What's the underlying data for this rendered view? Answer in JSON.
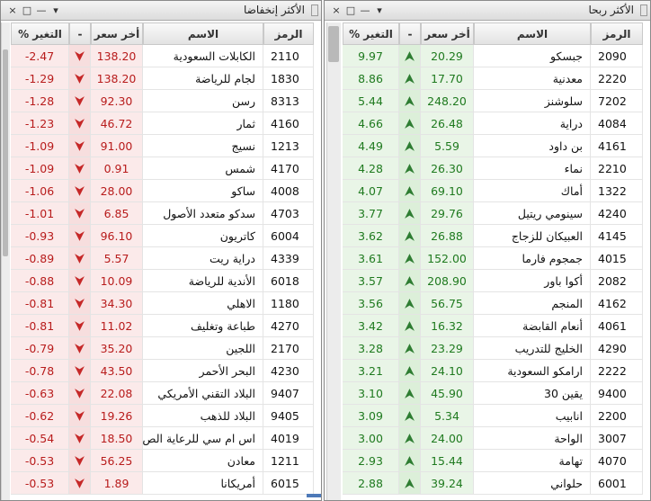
{
  "panels": {
    "losers": {
      "title": "الأكثر إنخفاضا",
      "columns": {
        "symbol": "الرمز",
        "name": "الاسم",
        "last_price": "أخر سعر",
        "trend": "-",
        "change": "التغير %"
      },
      "arrow_direction": "down",
      "rows": [
        {
          "symbol": "2110",
          "name": "الكابلات السعودية",
          "price": "138.20",
          "change": "-2.47"
        },
        {
          "symbol": "1830",
          "name": "لجام للرياضة",
          "price": "138.20",
          "change": "-1.29"
        },
        {
          "symbol": "8313",
          "name": "رسن",
          "price": "92.30",
          "change": "-1.28"
        },
        {
          "symbol": "4160",
          "name": "ثمار",
          "price": "46.72",
          "change": "-1.23"
        },
        {
          "symbol": "1213",
          "name": "نسيج",
          "price": "91.00",
          "change": "-1.09"
        },
        {
          "symbol": "4170",
          "name": "شمس",
          "price": "0.91",
          "change": "-1.09"
        },
        {
          "symbol": "4008",
          "name": "ساكو",
          "price": "28.00",
          "change": "-1.06"
        },
        {
          "symbol": "4703",
          "name": "سدكو متعدد الأصول",
          "price": "6.85",
          "change": "-1.01"
        },
        {
          "symbol": "6004",
          "name": "كاتريون",
          "price": "96.10",
          "change": "-0.93"
        },
        {
          "symbol": "4339",
          "name": "دراية ريت",
          "price": "5.57",
          "change": "-0.89"
        },
        {
          "symbol": "6018",
          "name": "الأندية للرياضة",
          "price": "10.09",
          "change": "-0.88"
        },
        {
          "symbol": "1180",
          "name": "الاهلي",
          "price": "34.30",
          "change": "-0.81"
        },
        {
          "symbol": "4270",
          "name": "طباعة وتغليف",
          "price": "11.02",
          "change": "-0.81"
        },
        {
          "symbol": "2170",
          "name": "اللجين",
          "price": "35.20",
          "change": "-0.79"
        },
        {
          "symbol": "4230",
          "name": "البحر الأحمر",
          "price": "43.50",
          "change": "-0.78"
        },
        {
          "symbol": "9407",
          "name": "البلاد التقني الأمريكي",
          "price": "22.08",
          "change": "-0.63"
        },
        {
          "symbol": "9405",
          "name": "البلاد للذهب",
          "price": "19.26",
          "change": "-0.62"
        },
        {
          "symbol": "4019",
          "name": "اس ام سي للرعاية الص",
          "price": "18.50",
          "change": "-0.54"
        },
        {
          "symbol": "1211",
          "name": "معادن",
          "price": "56.25",
          "change": "-0.53"
        },
        {
          "symbol": "6015",
          "name": "أمريكانا",
          "price": "1.89",
          "change": "-0.53"
        }
      ]
    },
    "gainers": {
      "title": "الأكثر ربحا",
      "columns": {
        "symbol": "الرمز",
        "name": "الاسم",
        "last_price": "أخر سعر",
        "trend": "-",
        "change": "التغير %"
      },
      "arrow_direction": "up",
      "rows": [
        {
          "symbol": "2090",
          "name": "جبسكو",
          "price": "20.29",
          "change": "9.97"
        },
        {
          "symbol": "2220",
          "name": "معدنية",
          "price": "17.70",
          "change": "8.86"
        },
        {
          "symbol": "7202",
          "name": "سلوشنز",
          "price": "248.20",
          "change": "5.44"
        },
        {
          "symbol": "4084",
          "name": "دراية",
          "price": "26.48",
          "change": "4.66"
        },
        {
          "symbol": "4161",
          "name": "بن داود",
          "price": "5.59",
          "change": "4.49"
        },
        {
          "symbol": "2210",
          "name": "نماء",
          "price": "26.30",
          "change": "4.28"
        },
        {
          "symbol": "1322",
          "name": "أماك",
          "price": "69.10",
          "change": "4.07"
        },
        {
          "symbol": "4240",
          "name": "سينومي ريتيل",
          "price": "29.76",
          "change": "3.77"
        },
        {
          "symbol": "4145",
          "name": "العبيكان للزجاج",
          "price": "26.88",
          "change": "3.62"
        },
        {
          "symbol": "4015",
          "name": "جمجوم فارما",
          "price": "152.00",
          "change": "3.61"
        },
        {
          "symbol": "2082",
          "name": "أكوا باور",
          "price": "208.90",
          "change": "3.57"
        },
        {
          "symbol": "4162",
          "name": "المنجم",
          "price": "56.75",
          "change": "3.56"
        },
        {
          "symbol": "4061",
          "name": "أنعام القابضة",
          "price": "16.32",
          "change": "3.42"
        },
        {
          "symbol": "4290",
          "name": "الخليج للتدريب",
          "price": "23.29",
          "change": "3.28"
        },
        {
          "symbol": "2222",
          "name": "ارامكو السعودية",
          "price": "24.10",
          "change": "3.21"
        },
        {
          "symbol": "9400",
          "name": "يقين 30",
          "price": "45.90",
          "change": "3.10"
        },
        {
          "symbol": "2200",
          "name": "انابيب",
          "price": "5.34",
          "change": "3.09"
        },
        {
          "symbol": "3007",
          "name": "الواحة",
          "price": "24.00",
          "change": "3.00"
        },
        {
          "symbol": "4070",
          "name": "تهامة",
          "price": "15.44",
          "change": "2.93"
        },
        {
          "symbol": "6001",
          "name": "حلواني",
          "price": "39.24",
          "change": "2.88"
        }
      ]
    }
  },
  "window_buttons": {
    "close": "×",
    "maximize": "□",
    "minimize": "—",
    "menu": "▾"
  },
  "colors": {
    "loss": "#c62828",
    "gain": "#2e7d32",
    "loss_bg": "#fbeaea",
    "gain_bg": "#e9f5e7"
  }
}
